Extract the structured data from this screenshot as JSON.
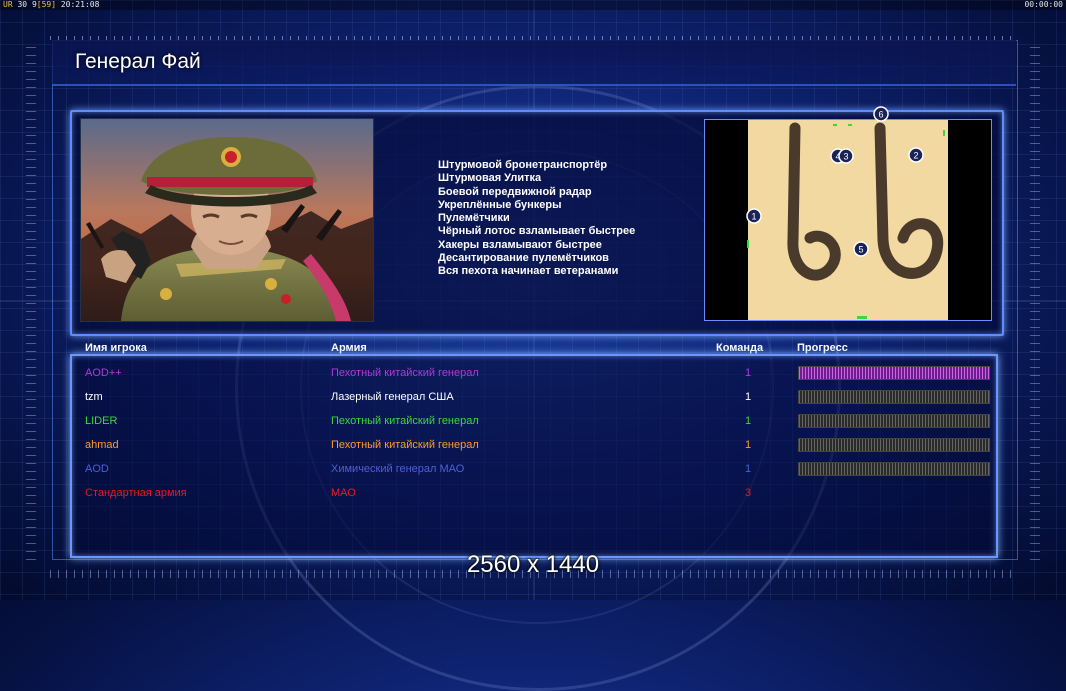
{
  "overlay": {
    "left_prefix": "UR",
    "left_a": "30",
    "left_b": "9",
    "left_c": "[59]",
    "left_time": "20:21:08",
    "right_time": "00:00:00"
  },
  "general": {
    "name": "Генерал Фай",
    "features": [
      "Штурмовой бронетранспортёр",
      "Штурмовая Улитка",
      "Боевой передвижной радар",
      "Укреплённые бункеры",
      "Пулемётчики",
      "Чёрный лотос взламывает быстрее",
      "Хакеры взламывают быстрее",
      "Десантирование пулемётчиков",
      "Вся пехота начинает ветеранами"
    ]
  },
  "map": {
    "markers": [
      {
        "label": "6"
      },
      {
        "label": "4"
      },
      {
        "label": "3"
      },
      {
        "label": "2"
      },
      {
        "label": "1"
      },
      {
        "label": "5"
      }
    ]
  },
  "table": {
    "headers": {
      "player": "Имя игрока",
      "army": "Армия",
      "team": "Команда",
      "progress": "Прогресс"
    },
    "rows": [
      {
        "name": "AOD++",
        "army": "Пехотный китайский генерал",
        "team": "1",
        "color": "#b03ad8",
        "progress": 1.0,
        "progress_color": "#d060e8"
      },
      {
        "name": "tzm",
        "army": "Лазерный генерал США",
        "team": "1",
        "color": "#ffffff",
        "progress": 0,
        "progress_color": "#888888"
      },
      {
        "name": "LIDER",
        "army": "Пехотный китайский генерал",
        "team": "1",
        "color": "#3ad83a",
        "progress": 0,
        "progress_color": "#888888"
      },
      {
        "name": "ahmad",
        "army": "Пехотный китайский генерал",
        "team": "1",
        "color": "#ff9a2a",
        "progress": 0,
        "progress_color": "#888888"
      },
      {
        "name": "AOD",
        "army": "Химический генерал МАО",
        "team": "1",
        "color": "#4f5fd8",
        "progress": 0,
        "progress_color": "#888888"
      },
      {
        "name": "Стандартная армия",
        "army": "МАО",
        "team": "3",
        "color": "#e81b1b",
        "progress": null,
        "progress_color": "#888888"
      }
    ]
  },
  "resolution_label": "2560 x 1440",
  "colors": {
    "frame": "#5f8cff",
    "background": "#0e2270",
    "map_sand": "#f1d9a1",
    "map_path": "#4a3a2c"
  }
}
